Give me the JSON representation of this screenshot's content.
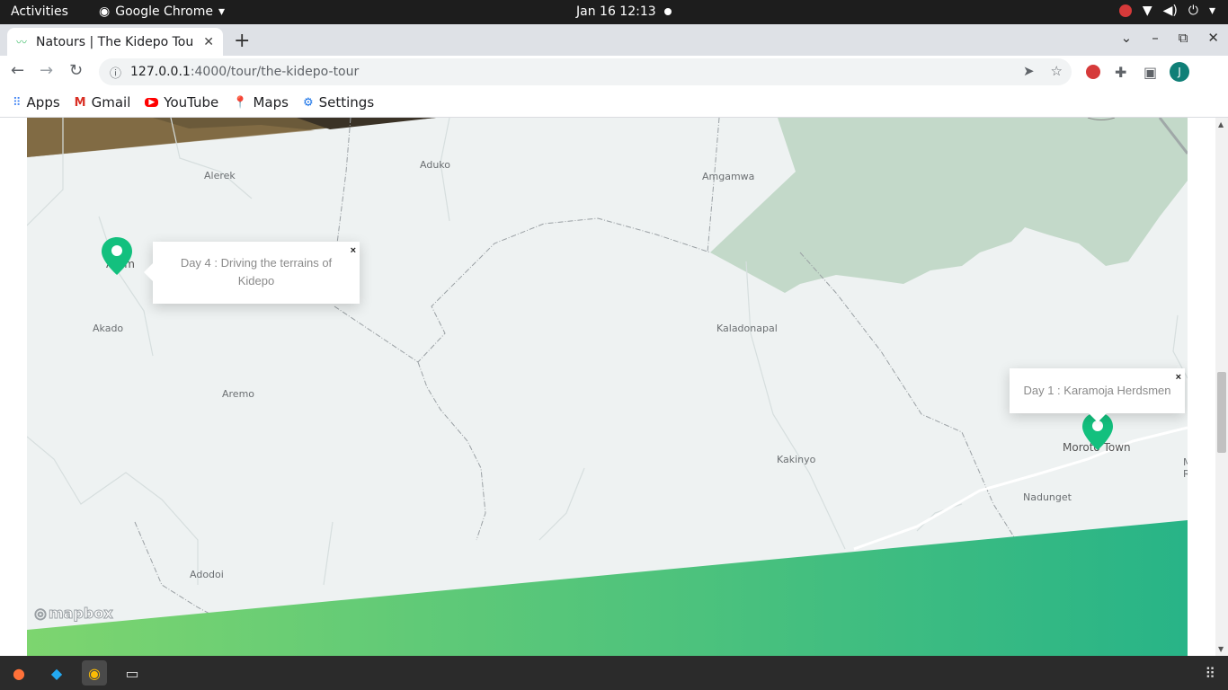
{
  "system": {
    "activities": "Activities",
    "app_name": "Google Chrome",
    "clock": "Jan 16  12:13"
  },
  "browser": {
    "tab_title": "Natours | The Kidepo Tour",
    "url_host": "127.0.0.1",
    "url_path": ":4000/tour/the-kidepo-tour",
    "profile_initial": "J"
  },
  "bookmarks": [
    {
      "label": "Apps",
      "icon": "apps-grid-icon"
    },
    {
      "label": "Gmail",
      "icon": "gmail-icon"
    },
    {
      "label": "YouTube",
      "icon": "youtube-icon"
    },
    {
      "label": "Maps",
      "icon": "maps-icon"
    },
    {
      "label": "Settings",
      "icon": "gear-icon"
    }
  ],
  "map": {
    "places": {
      "alerek": "Alerek",
      "aduku": "Aduko",
      "amgamwa": "Amgamwa",
      "akado": "Akado",
      "aremo": "Aremo",
      "kaladonapal": "Kaladonapal",
      "kakinyo": "Kakinyo",
      "moroto": "Moroto Town",
      "nadunget": "Nadunget",
      "adodoi": "Adodoi",
      "atum": "Atum",
      "edge_m": "M",
      "edge_r": "R"
    },
    "popups": {
      "day4": "Day 4 : Driving the terrains of Kidepo",
      "day1": "Day 1 : Karamoja Herdsmen"
    },
    "popup_close": "×",
    "attribution": "mapbox",
    "colors": {
      "marker": "#13c07e",
      "park": "#c3d9c9",
      "band_start": "#7dd56f",
      "band_end": "#28b487"
    }
  }
}
